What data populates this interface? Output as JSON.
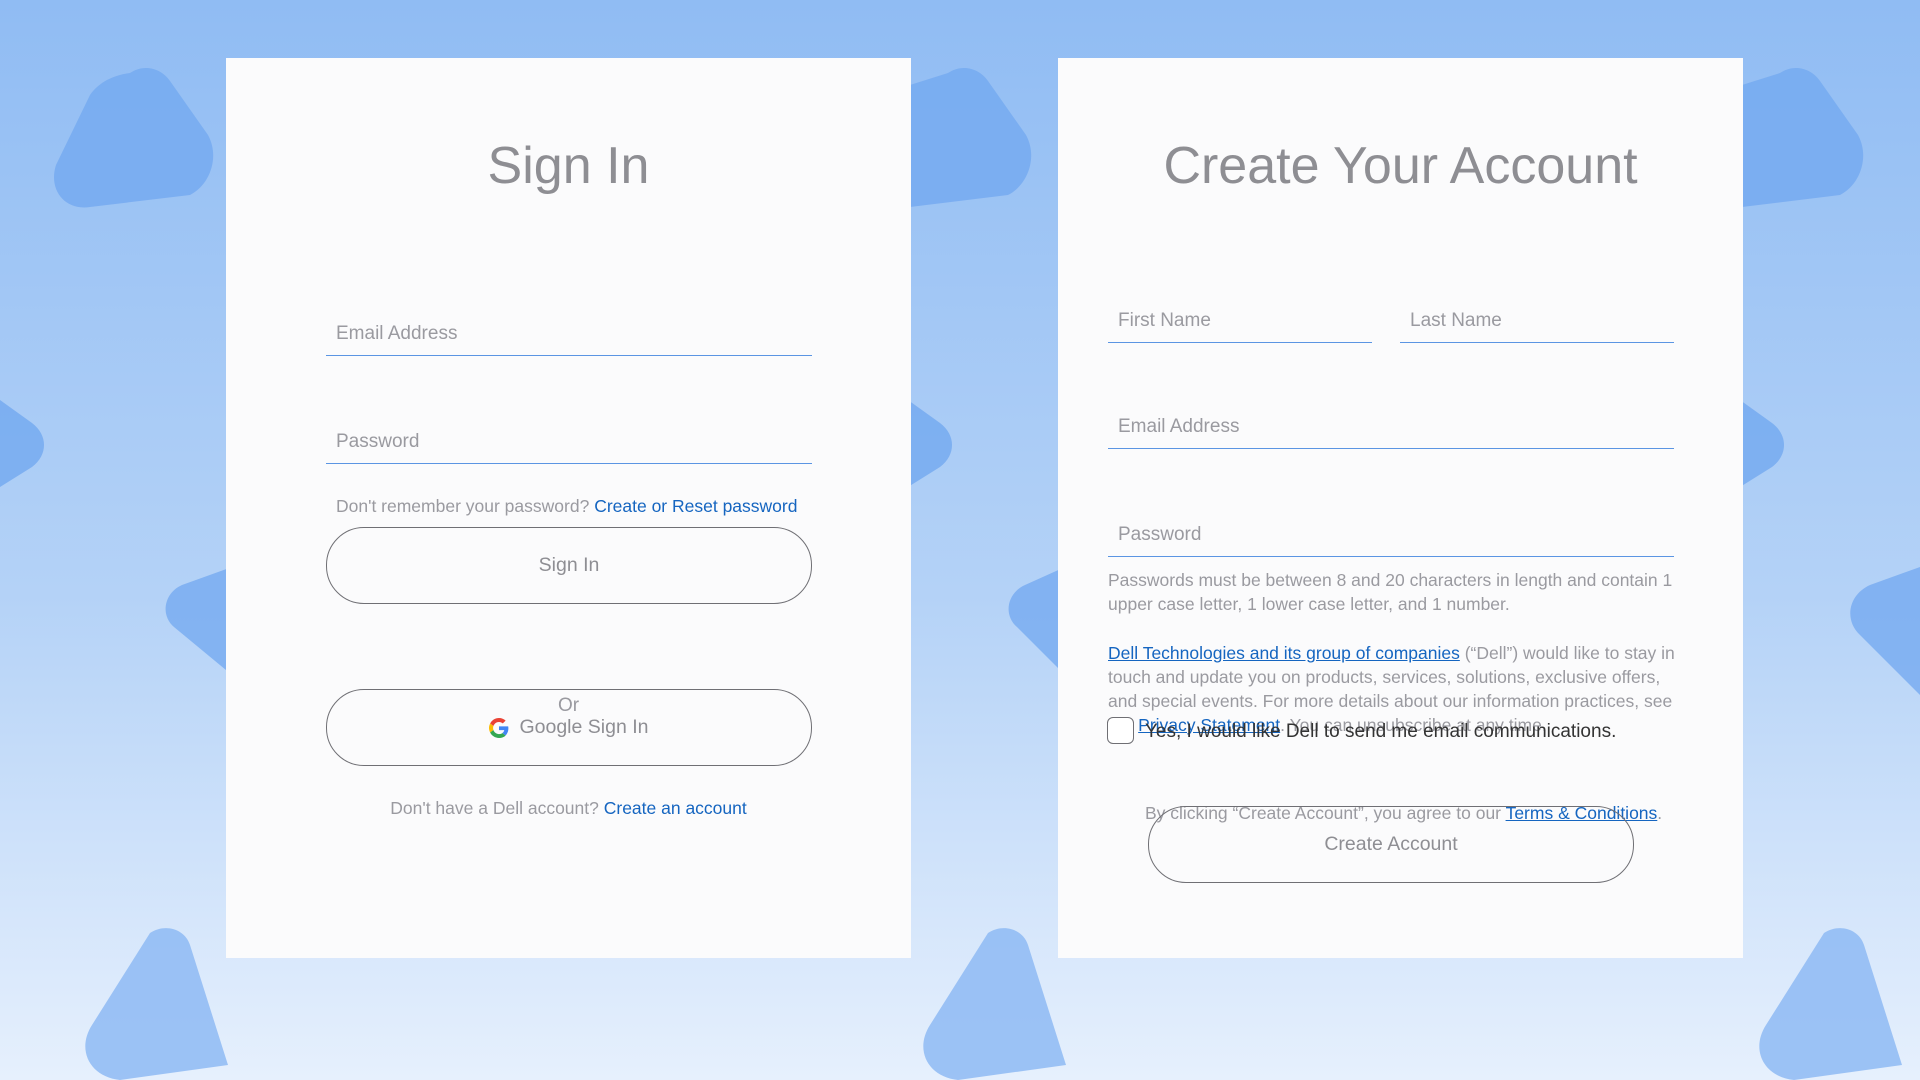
{
  "signin": {
    "title": "Sign In",
    "email_placeholder": "Email Address",
    "password_placeholder": "Password",
    "forgot_text": "Don't remember your password?",
    "forgot_link": "Create or Reset password",
    "signin_button": "Sign In",
    "or_text": "Or",
    "google_button": "Google Sign In",
    "no_account_text": "Don't have a Dell account?",
    "create_link": "Create an account"
  },
  "create": {
    "title": "Create Your Account",
    "first_name_placeholder": "First Name",
    "last_name_placeholder": "Last Name",
    "email_placeholder": "Email Address",
    "password_placeholder": "Password",
    "password_hint": "Passwords must be between 8 and 20 characters in length and contain 1 upper case letter, 1 lower case letter, and 1 number.",
    "privacy": {
      "companies_link": "Dell Technologies and its group of companies",
      "text_1": " (“Dell”) would like to stay in touch and update you on products, services, solutions, exclusive offers, and special events. For more details about our information practices, see our ",
      "privacy_link": "Privacy Statement",
      "text_2": ". You can unsubscribe at any time."
    },
    "checkbox_label": "Yes, I would like Dell to send me email communications.",
    "agree_text": "By clicking “Create Account”, you agree to our ",
    "terms_link": "Terms & Conditions",
    "agree_end": ".",
    "create_button": "Create Account"
  },
  "colors": {
    "accent": "#1565c0",
    "field_line": "#5b95e3",
    "background_top": "#90bcf3",
    "background_bottom": "#e6f0fd",
    "shape": "#7fb0f0"
  },
  "icons": {
    "google": "google-g-icon",
    "decor": "rounded-triangle-shape"
  }
}
